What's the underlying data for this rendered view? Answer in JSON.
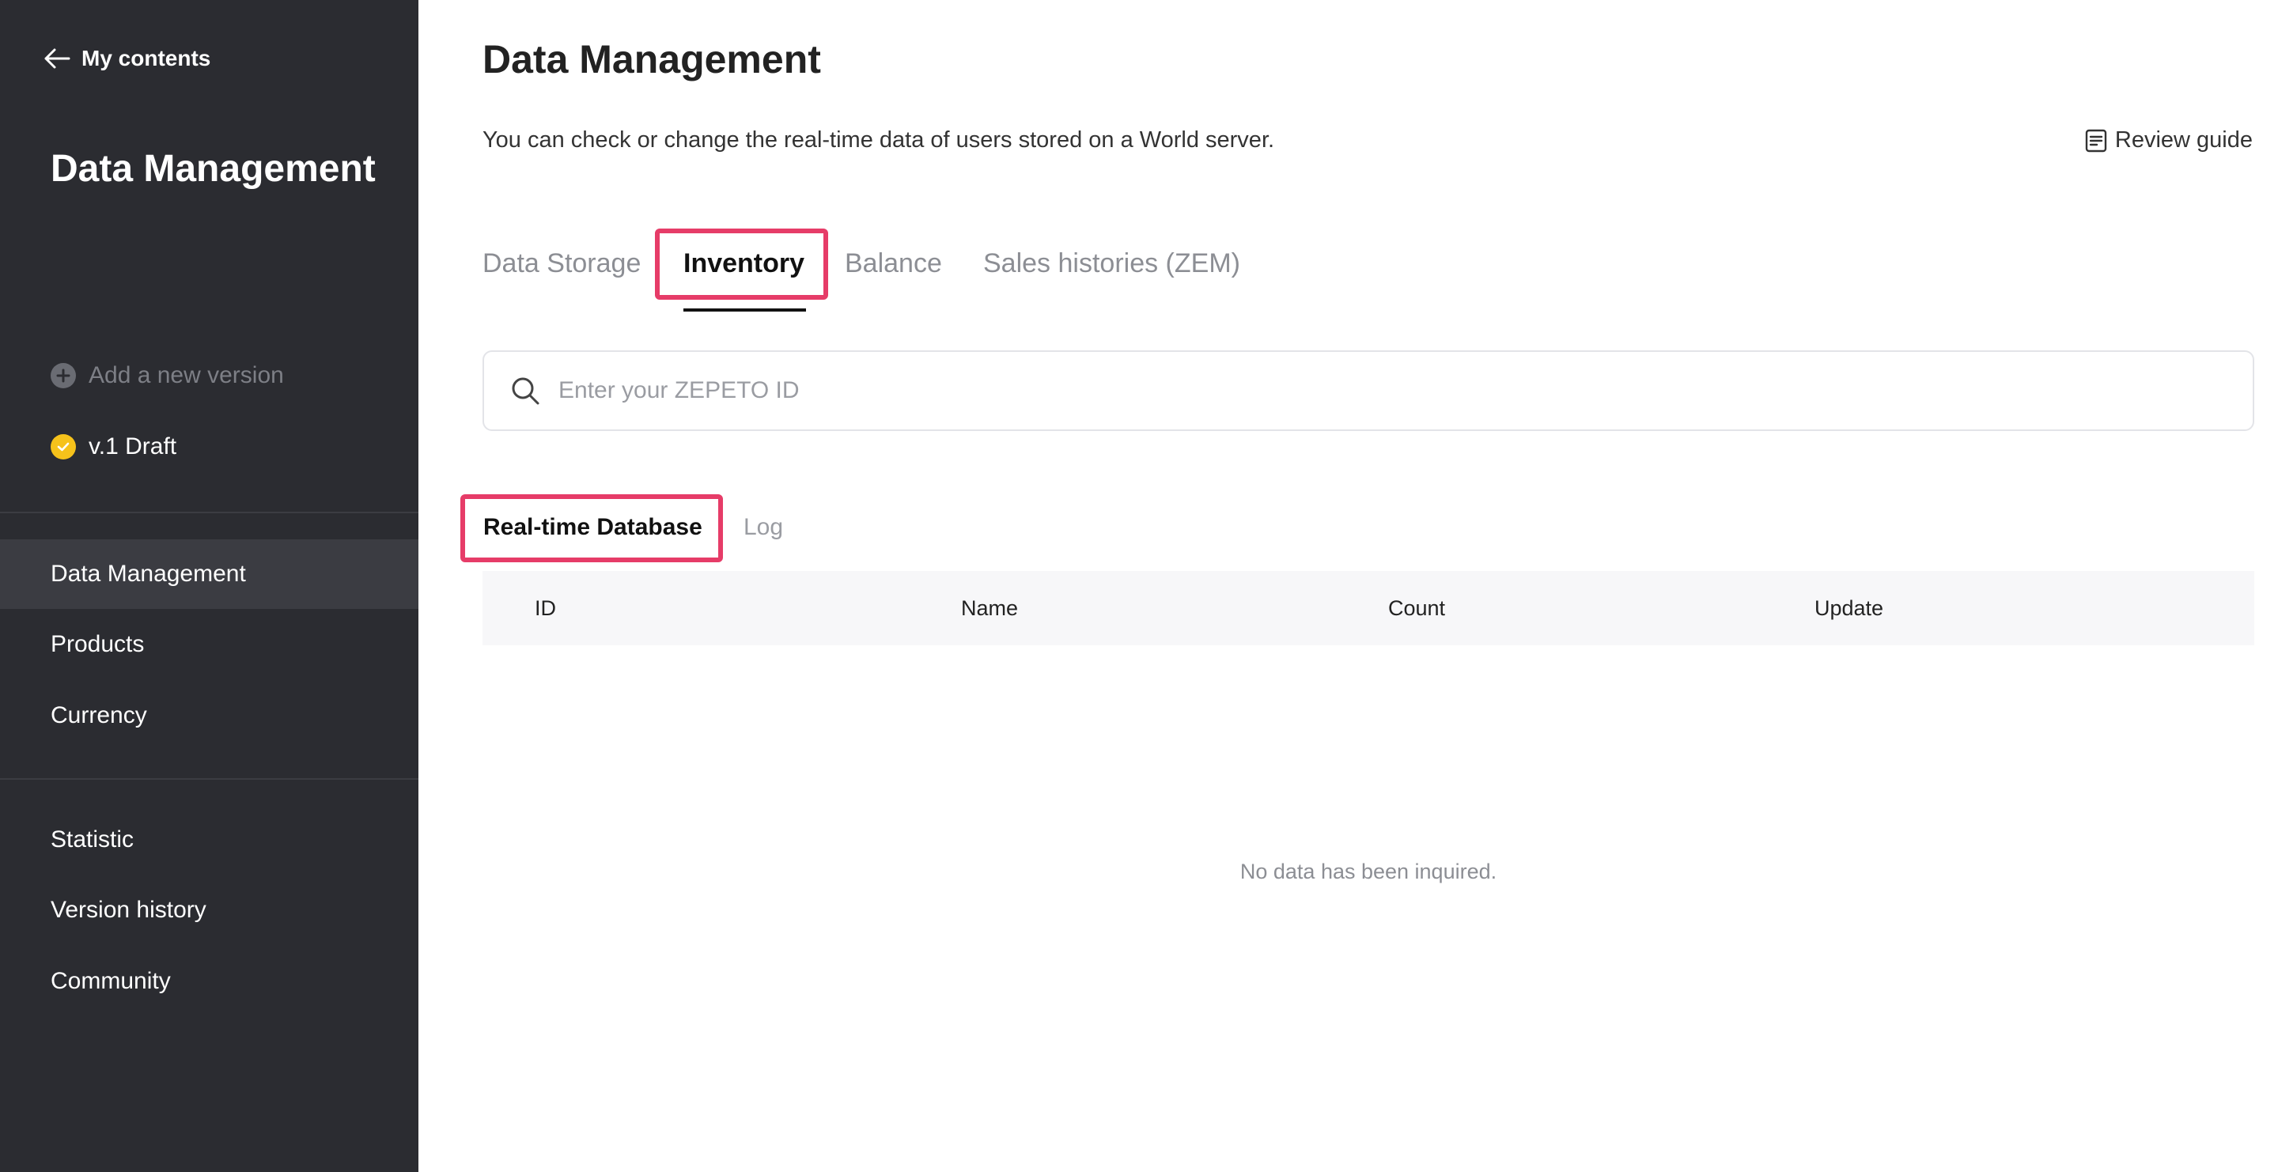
{
  "sidebar": {
    "back_label": "My contents",
    "title": "Data Management",
    "add_version_label": "Add a new version",
    "version_label": "v.1 Draft",
    "nav_primary": [
      {
        "label": "Data Management",
        "active": true
      },
      {
        "label": "Products",
        "active": false
      },
      {
        "label": "Currency",
        "active": false
      }
    ],
    "nav_secondary": [
      {
        "label": "Statistic"
      },
      {
        "label": "Version history"
      },
      {
        "label": "Community"
      }
    ]
  },
  "main": {
    "title": "Data Management",
    "description": "You can check or change the real-time data of users stored on a World server.",
    "review_guide_label": "Review guide",
    "tabs": [
      {
        "label": "Data Storage",
        "active": false
      },
      {
        "label": "Inventory",
        "active": true
      },
      {
        "label": "Balance",
        "active": false
      },
      {
        "label": "Sales histories (ZEM)",
        "active": false
      }
    ],
    "search": {
      "placeholder": "Enter your ZEPETO ID",
      "value": ""
    },
    "subtabs": [
      {
        "label": "Real-time Database",
        "active": true
      },
      {
        "label": "Log",
        "active": false
      }
    ],
    "table": {
      "columns": [
        "ID",
        "Name",
        "Count",
        "Update"
      ],
      "rows": [],
      "empty_message": "No data has been inquired."
    }
  },
  "colors": {
    "sidebar_bg": "#2b2c31",
    "sidebar_active": "#3b3c42",
    "highlight": "#e63c68",
    "version_badge": "#f6c21b"
  },
  "icons": {
    "back": "arrow-left-icon",
    "add": "plus-circle-icon",
    "version": "check-circle-icon",
    "guide": "document-icon",
    "search": "search-icon"
  }
}
